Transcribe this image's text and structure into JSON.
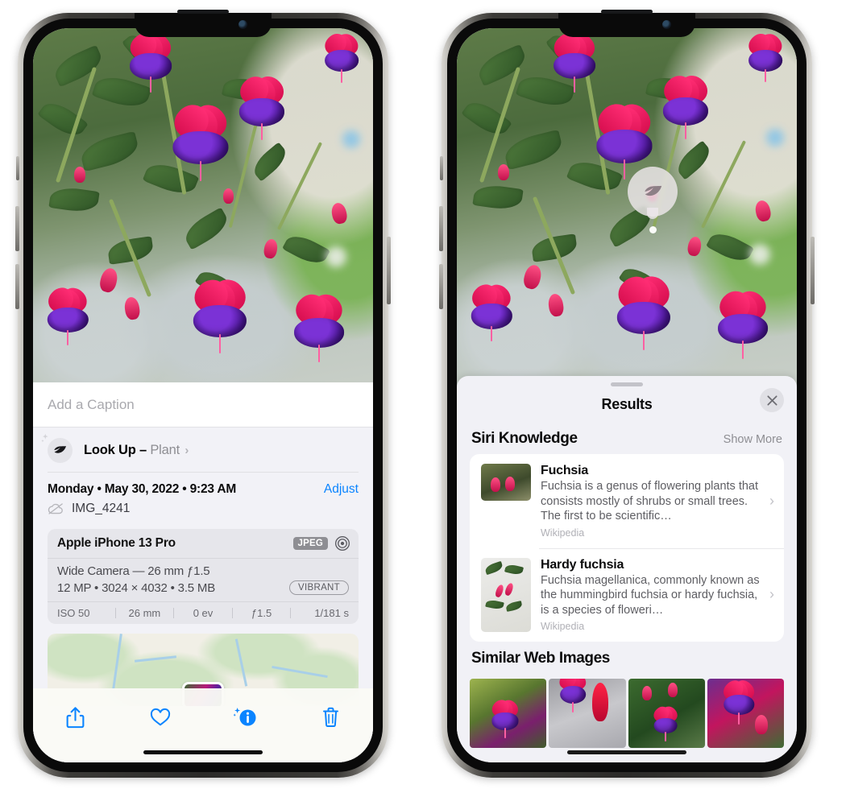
{
  "left_phone": {
    "caption_placeholder": "Add a Caption",
    "lookup": {
      "icon": "leaf-icon",
      "label": "Look Up –",
      "subject": "Plant",
      "chevron": "›"
    },
    "metadata": {
      "date": "Monday • May 30, 2022 • 9:23 AM",
      "adjust_label": "Adjust",
      "cloud_icon": "cloud-slash-icon",
      "filename": "IMG_4241"
    },
    "camera_card": {
      "device": "Apple iPhone 13 Pro",
      "format_badge": "JPEG",
      "lens_icon": "aperture-icon",
      "lens_line": "Wide Camera — 26 mm ƒ1.5",
      "size_line": "12 MP • 3024 × 4032 • 3.5 MB",
      "style_badge": "VIBRANT",
      "exif": [
        "ISO 50",
        "26 mm",
        "0 ev",
        "ƒ1.5",
        "1/181 s"
      ]
    },
    "toolbar": [
      {
        "name": "share-icon",
        "label": "Share"
      },
      {
        "name": "heart-icon",
        "label": "Favorite"
      },
      {
        "name": "info-icon",
        "label": "Info"
      },
      {
        "name": "trash-icon",
        "label": "Delete"
      }
    ],
    "accent_color": "#0a84ff"
  },
  "right_phone": {
    "visual_lookup_badge": {
      "icon": "leaf-icon"
    },
    "sheet": {
      "title": "Results",
      "close_icon": "close-icon",
      "sections": [
        {
          "title": "Siri Knowledge",
          "action": "Show More",
          "items": [
            {
              "title": "Fuchsia",
              "description": "Fuchsia is a genus of flowering plants that consists mostly of shrubs or small trees. The first to be scientific…",
              "source": "Wikipedia",
              "chevron": "›"
            },
            {
              "title": "Hardy fuchsia",
              "description": "Fuchsia magellanica, commonly known as the hummingbird fuchsia or hardy fuchsia, is a species of floweri…",
              "source": "Wikipedia",
              "chevron": "›"
            }
          ]
        },
        {
          "title": "Similar Web Images",
          "thumbnails": [
            "fuchsia-thumb-1",
            "fuchsia-thumb-2",
            "fuchsia-thumb-3",
            "fuchsia-thumb-4"
          ]
        }
      ]
    }
  }
}
